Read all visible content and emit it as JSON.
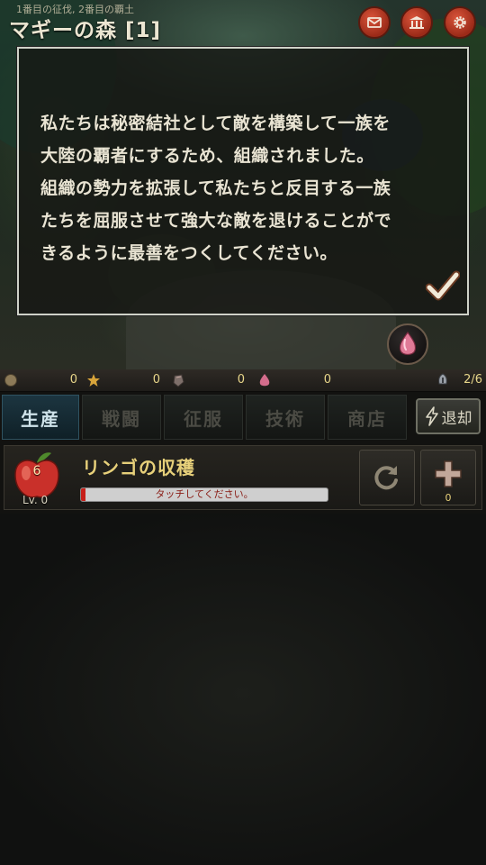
{
  "header": {
    "subtitle": "1番目の征伐, 2番目の覇土",
    "title": "マギーの森 [1]",
    "buttons": [
      {
        "name": "mail",
        "icon": "envelope-icon"
      },
      {
        "name": "bank",
        "icon": "temple-icon"
      },
      {
        "name": "settings",
        "icon": "gear-icon"
      }
    ]
  },
  "dialog": {
    "lines": [
      "私たちは秘密結社として敵を構築して一族を",
      "大陸の覇者にするため、組織されました。",
      "組織の勢力を拡張して私たちと反目する一族",
      "たちを屈服させて強大な敵を退けることがで",
      "きるように最善をつくしてください。"
    ],
    "confirm_icon": "checkmark-icon"
  },
  "item_button": {
    "icon": "pink-gem-icon"
  },
  "resources": [
    {
      "icon": "coin-icon",
      "value": "0"
    },
    {
      "icon": "star-icon",
      "value": "0"
    },
    {
      "icon": "stone-icon",
      "value": "0"
    },
    {
      "icon": "crystal-icon",
      "value": "0"
    },
    {
      "icon": "soldier-icon",
      "value": "2/6"
    }
  ],
  "tabs": [
    {
      "label": "生産",
      "active": true
    },
    {
      "label": "戦闘",
      "active": false
    },
    {
      "label": "征服",
      "active": false
    },
    {
      "label": "技術",
      "active": false
    },
    {
      "label": "商店",
      "active": false
    }
  ],
  "retreat": {
    "label": "退却",
    "icon": "lightning-icon"
  },
  "production": {
    "item_name": "リンゴの収穫",
    "count": "6",
    "level": "Lv. 0",
    "progress_text": "タッチしてください。",
    "progress": 0.02,
    "plus_count": "0"
  },
  "colors": {
    "accent_red": "#c7201a",
    "gold_text": "#e7d07a",
    "active_tab": "#1c3540"
  }
}
